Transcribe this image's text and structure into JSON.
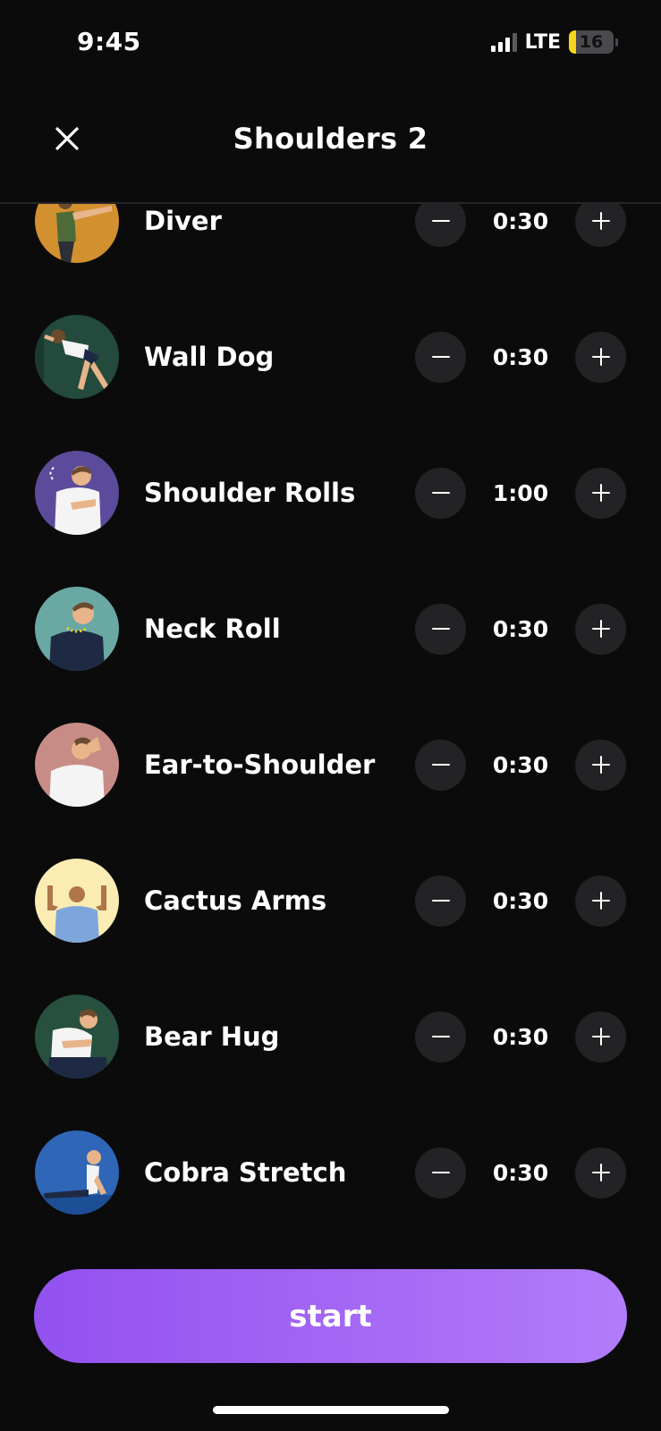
{
  "status_bar": {
    "time": "9:45",
    "network": "LTE",
    "battery_level": "16",
    "battery_color": "#f7d51c"
  },
  "header": {
    "title": "Shoulders 2",
    "close_icon": "close-icon"
  },
  "exercises": [
    {
      "name": "Diver",
      "duration": "0:30",
      "thumb_bg": "#d3902f"
    },
    {
      "name": "Wall Dog",
      "duration": "0:30",
      "thumb_bg": "#234a3c"
    },
    {
      "name": "Shoulder Rolls",
      "duration": "1:00",
      "thumb_bg": "#5c4b9a"
    },
    {
      "name": "Neck Roll",
      "duration": "0:30",
      "thumb_bg": "#6aa8a4"
    },
    {
      "name": "Ear-to-Shoulder",
      "duration": "0:30",
      "thumb_bg": "#c88c86"
    },
    {
      "name": "Cactus Arms",
      "duration": "0:30",
      "thumb_bg": "#fbecb3"
    },
    {
      "name": "Bear Hug",
      "duration": "0:30",
      "thumb_bg": "#27503f"
    },
    {
      "name": "Cobra Stretch",
      "duration": "0:30",
      "thumb_bg": "#2f66b8"
    }
  ],
  "controls": {
    "decrease_icon": "minus-icon",
    "increase_icon": "plus-icon"
  },
  "start_button": {
    "label": "start",
    "color": "#a468f5"
  }
}
